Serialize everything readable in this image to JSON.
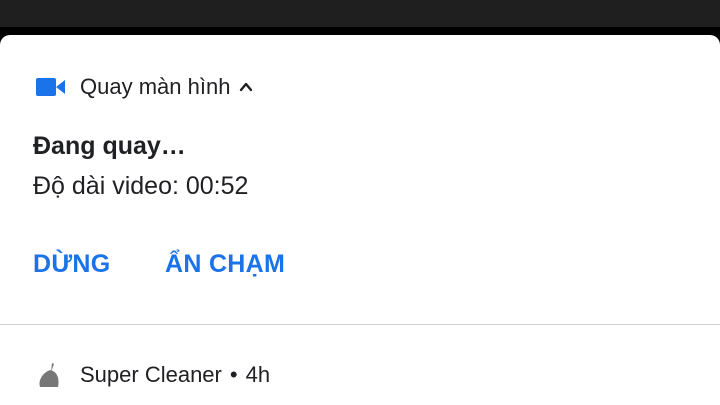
{
  "notification": {
    "app_name": "Quay màn hình",
    "title": "Đang quay…",
    "text": "Độ dài video: 00:52",
    "actions": {
      "stop": "DỪNG",
      "hide_touches": "ẨN CHẠM"
    },
    "accent_color": "#1a73e8",
    "icon": "videocam-icon"
  },
  "second_notification": {
    "app_name": "Super Cleaner",
    "separator": "•",
    "time": "4h",
    "icon": "broom-icon"
  }
}
